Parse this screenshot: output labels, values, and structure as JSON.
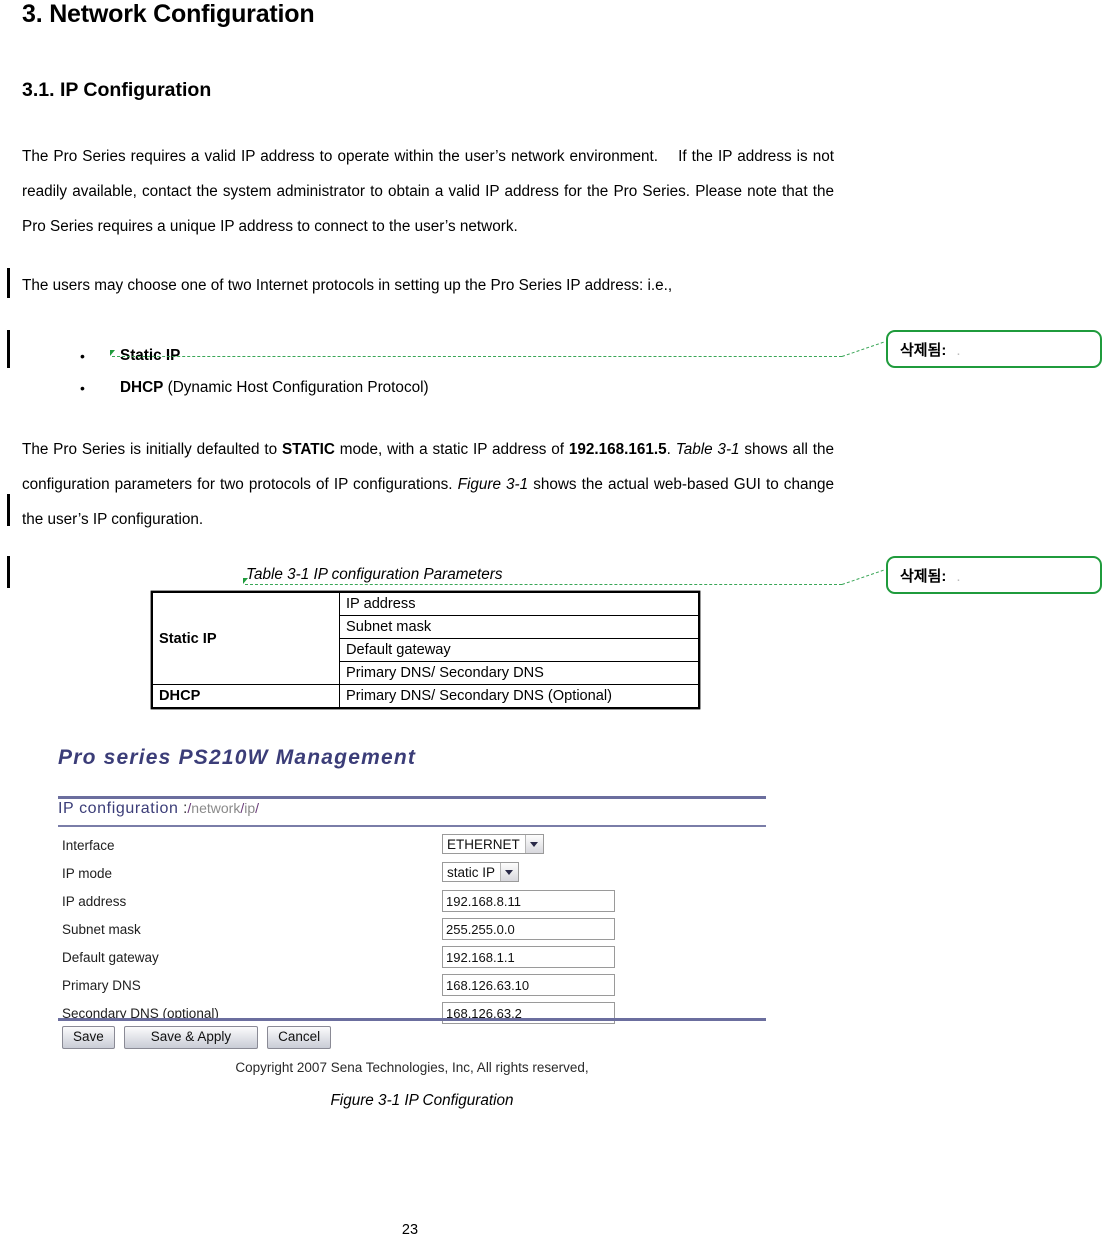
{
  "document": {
    "heading1": "3. Network Configuration",
    "heading2": "3.1. IP Configuration",
    "paragraph1_a": "The Pro Series requires a valid IP address to operate within the user’s network environment.",
    "paragraph1_b": "If the IP address is not readily available, contact the system administrator to obtain a valid IP address for the Pro Series. Please note that the Pro Series requires a unique IP address to connect to the user’s network.",
    "paragraph2": "The users may choose one of two Internet protocols in setting up the Pro Series IP address: i.e.,",
    "bullets": [
      {
        "marker": "•",
        "bold": "Static IP",
        "rest": ""
      },
      {
        "marker": "•",
        "bold": "DHCP",
        "rest": " (Dynamic Host Configuration Protocol)"
      }
    ],
    "paragraph3": {
      "s1": "The Pro Series is initially defaulted to ",
      "b1": "STATIC",
      "s2": " mode, with a static IP address of ",
      "b2": "192.168.161.5",
      "s3": ". ",
      "i1": "Table 3-1",
      "s4": " shows all the configuration parameters for two protocols of IP configurations. ",
      "i2": "Figure 3-1",
      "s5": " shows the actual web-based GUI to change the user’s IP configuration."
    },
    "page_number": "23"
  },
  "revisions": {
    "balloon_label": "삭제됨:",
    "balloon_value": ".",
    "balloons": [
      {
        "label": "삭제됨:",
        "value": "."
      },
      {
        "label": "삭제됨:",
        "value": "."
      }
    ],
    "accent_color": "#1f9b3c"
  },
  "table31": {
    "caption": "Table 3-1 IP configuration Parameters",
    "rows": [
      {
        "protocol": "Static IP",
        "parameter": "IP address"
      },
      {
        "protocol": "",
        "parameter": "Subnet mask"
      },
      {
        "protocol": "",
        "parameter": "Default gateway"
      },
      {
        "protocol": "",
        "parameter": "Primary DNS/ Secondary DNS"
      },
      {
        "protocol": "DHCP",
        "parameter": "Primary DNS/ Secondary DNS (Optional)"
      }
    ],
    "protocol_static": "Static IP",
    "protocol_dhcp": "DHCP"
  },
  "figure31": {
    "caption": "Figure 3-1 IP Configuration",
    "gui": {
      "product_title": "Pro series PS210W Management",
      "section_title": "IP configuration",
      "path_colon": ":",
      "path_seg1": "network",
      "path_seg2": "ip",
      "slash": "/",
      "title_color": "#3b3d78",
      "rule_color": "#6b6e9e",
      "fields": [
        {
          "label": "Interface",
          "type": "select",
          "value": "ETHERNET"
        },
        {
          "label": "IP mode",
          "type": "select",
          "value": "static IP"
        },
        {
          "label": "IP address",
          "type": "text",
          "value": "192.168.8.11"
        },
        {
          "label": "Subnet mask",
          "type": "text",
          "value": "255.255.0.0"
        },
        {
          "label": "Default gateway",
          "type": "text",
          "value": "192.168.1.1"
        },
        {
          "label": "Primary DNS",
          "type": "text",
          "value": "168.126.63.10"
        },
        {
          "label": "Secondary DNS (optional)",
          "type": "text",
          "value": "168.126.63.2"
        }
      ],
      "buttons": [
        {
          "label": "Save"
        },
        {
          "label": "Save & Apply"
        },
        {
          "label": "Cancel"
        }
      ],
      "copyright": "Copyright 2007 Sena Technologies, Inc, All rights reserved,"
    }
  }
}
